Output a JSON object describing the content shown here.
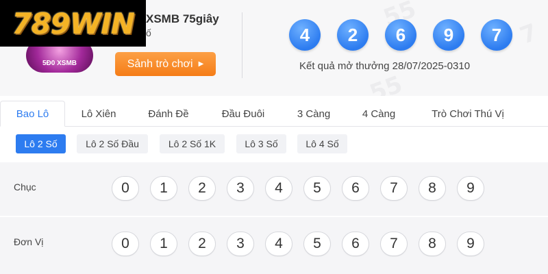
{
  "logo": {
    "text": "789WIN"
  },
  "game": {
    "badge_text": "5Đ0 XSMB",
    "title": "XSMB 75giây",
    "subtitle": "ố",
    "lobby_button": "Sảnh trò chơi",
    "lobby_arrow": "▶"
  },
  "result": {
    "balls": [
      "4",
      "2",
      "6",
      "9",
      "7"
    ],
    "label": "Kết quả mở thưởng 28/07/2025-0310"
  },
  "tabs": [
    "Bao Lô",
    "Lô Xiên",
    "Đánh Đề",
    "Đầu Đuôi",
    "3 Càng",
    "4 Càng",
    "Trò Chơi Thú Vị"
  ],
  "subtabs": [
    "Lô 2 Số",
    "Lô 2 Số Đầu",
    "Lô 2 Số 1K",
    "Lô 3 Số",
    "Lô 4 Số"
  ],
  "rows": [
    {
      "label": "Chục",
      "numbers": [
        "0",
        "1",
        "2",
        "3",
        "4",
        "5",
        "6",
        "7",
        "8",
        "9"
      ]
    },
    {
      "label": "Đơn Vị",
      "numbers": [
        "0",
        "1",
        "2",
        "3",
        "4",
        "5",
        "6",
        "7",
        "8",
        "9"
      ]
    }
  ],
  "colors": {
    "accent": "#2d7cf0",
    "button": "#f57d17",
    "logo": "#f4b325"
  }
}
